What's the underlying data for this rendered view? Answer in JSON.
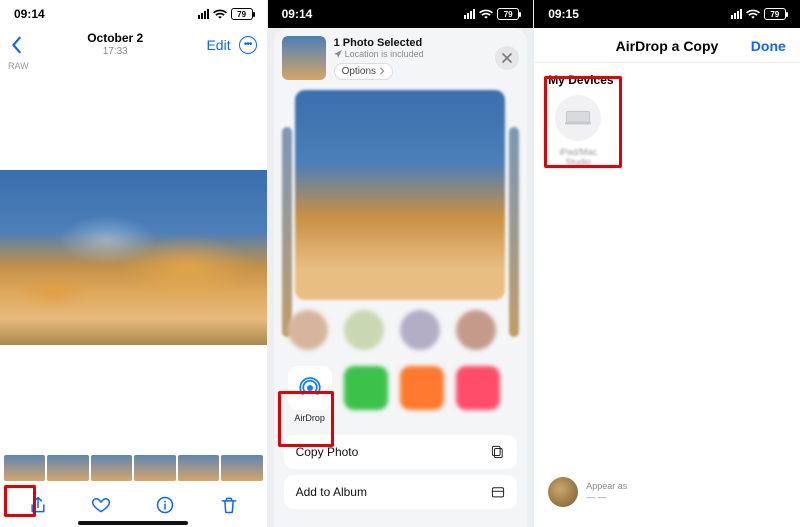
{
  "phone1": {
    "status": {
      "time": "09:14",
      "battery": "79"
    },
    "nav": {
      "date": "October 2",
      "time": "17:33",
      "edit": "Edit"
    },
    "raw_badge": "RAW"
  },
  "phone2": {
    "status": {
      "time": "09:14",
      "battery": "79"
    },
    "header": {
      "title": "1 Photo Selected",
      "location_note": "Location is included",
      "options": "Options"
    },
    "airdrop_label": "AirDrop",
    "actions": {
      "copy": "Copy Photo",
      "add_album": "Add to Album"
    }
  },
  "phone3": {
    "status": {
      "time": "09:15",
      "battery": "79"
    },
    "title": "AirDrop a Copy",
    "done": "Done",
    "section": "My Devices",
    "device_name": "iPad/Mac Studio",
    "footer_label": "Appear as"
  },
  "colors": {
    "ios_blue": "#0a66ff",
    "highlight_red": "#e30000"
  }
}
